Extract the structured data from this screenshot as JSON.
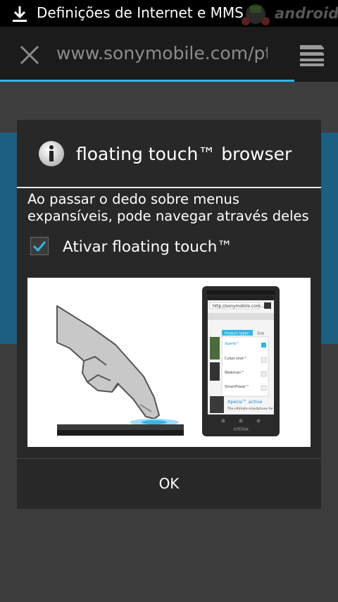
{
  "status_bar": {
    "title": "Definições de Internet e MMS",
    "watermark": "androidPT"
  },
  "browser": {
    "url": "www.sonymobile.com/pt",
    "load_progress": 0.87
  },
  "dialog": {
    "title": "floating touch™ browser",
    "message": "Ao passar o dedo sobre menus expansíveis, pode navegar através deles",
    "checkbox": {
      "label": "Ativar floating touch™",
      "checked": true
    },
    "illustration": {
      "phone_url": "http://sonymobile.com...",
      "menu_header": "Product types",
      "menu_side": "Size",
      "menu_items": [
        "Xperia™",
        "Cyber-shot™",
        "Walkman™",
        "SmartPower™"
      ],
      "promo_title": "Xperia™ active",
      "promo_sub": "The ultimate smartphone for",
      "brand": "XPERIA"
    },
    "ok_label": "OK"
  },
  "colors": {
    "accent": "#33b5e5",
    "dialog_bg": "#282828"
  }
}
